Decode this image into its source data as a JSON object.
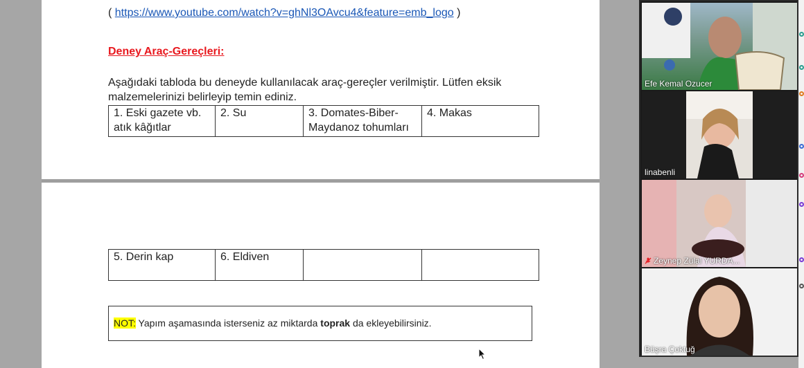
{
  "document": {
    "link_open": "( ",
    "link_url": "https://www.youtube.com/watch?v=ghNl3OAvcu4&feature=emb_logo",
    "link_close": " )",
    "heading": "Deney Araç-Gereçleri:",
    "paragraph": "Aşağıdaki tabloda bu deneyde kullanılacak araç-gereçler verilmiştir. Lütfen eksik malzemelerinizi belirleyip temin ediniz.",
    "table_row1": [
      "1. Eski gazete vb. atık kâğıtlar",
      "2. Su",
      "3. Domates-Biber-Maydanoz tohumları",
      "4. Makas"
    ],
    "table_row2": [
      "5. Derin kap",
      "6. Eldiven",
      "",
      ""
    ],
    "note": {
      "label": "NOT:",
      "text_before": " Yapım aşamasında isterseniz az miktarda ",
      "bold": "toprak",
      "text_after": " da ekleyebilirsiniz."
    }
  },
  "participants": [
    {
      "name": "Efe Kemal Ozucer",
      "muted": false
    },
    {
      "name": "linabenli",
      "muted": false
    },
    {
      "name": "Zeynep Zülal YURDA...",
      "muted": true
    },
    {
      "name": "Büşra Çoktuğ",
      "muted": false
    }
  ],
  "colors": {
    "heading": "#e8181e",
    "link": "#1a57b6",
    "note_highlight": "#ffff00",
    "muted_icon": "#e8181e"
  }
}
